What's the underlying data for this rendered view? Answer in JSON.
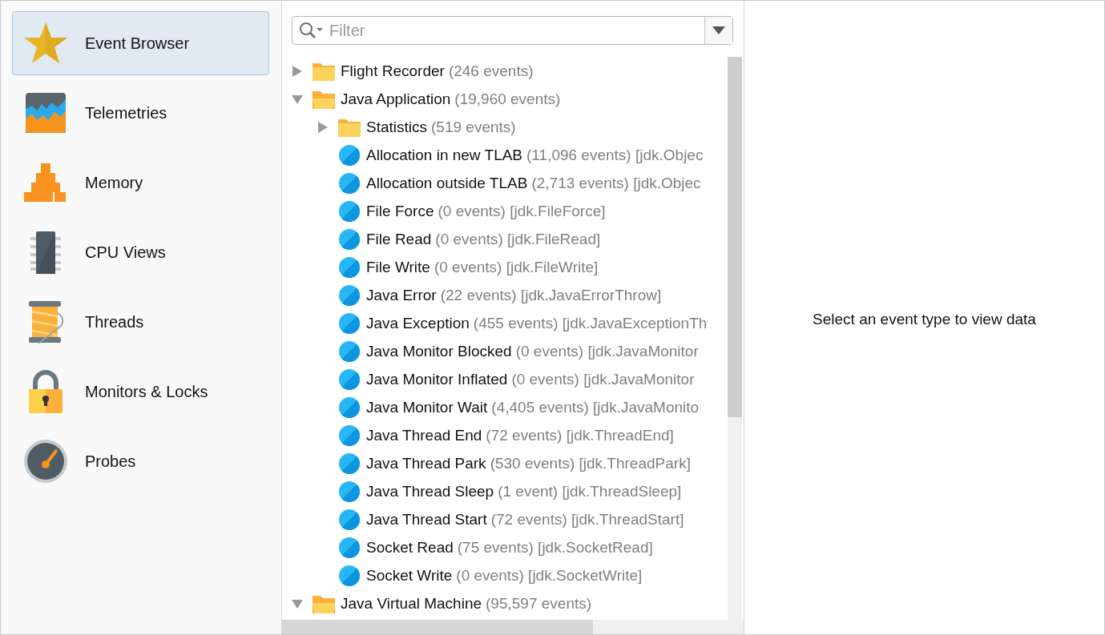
{
  "sidebar": {
    "items": [
      {
        "kind": "star",
        "label": "Event Browser",
        "selected": true
      },
      {
        "kind": "telemetry",
        "label": "Telemetries",
        "selected": false
      },
      {
        "kind": "memory",
        "label": "Memory",
        "selected": false
      },
      {
        "kind": "cpu",
        "label": "CPU Views",
        "selected": false
      },
      {
        "kind": "threads",
        "label": "Threads",
        "selected": false
      },
      {
        "kind": "lock",
        "label": "Monitors & Locks",
        "selected": false
      },
      {
        "kind": "probe",
        "label": "Probes",
        "selected": false
      }
    ]
  },
  "filter": {
    "placeholder": "Filter"
  },
  "tree": [
    {
      "kind": "folder",
      "label": "Flight Recorder",
      "detail": "(246 events)",
      "expanded": false
    },
    {
      "kind": "folder",
      "label": "Java Application",
      "detail": "(19,960 events)",
      "expanded": true,
      "children": [
        {
          "kind": "folder",
          "label": "Statistics",
          "detail": "(519 events)",
          "expanded": false
        },
        {
          "kind": "event",
          "label": "Allocation in new TLAB",
          "detail": "(11,096 events) [jdk.Objec"
        },
        {
          "kind": "event",
          "label": "Allocation outside TLAB",
          "detail": "(2,713 events) [jdk.Objec"
        },
        {
          "kind": "event",
          "label": "File Force",
          "detail": "(0 events) [jdk.FileForce]"
        },
        {
          "kind": "event",
          "label": "File Read",
          "detail": "(0 events) [jdk.FileRead]"
        },
        {
          "kind": "event",
          "label": "File Write",
          "detail": "(0 events) [jdk.FileWrite]"
        },
        {
          "kind": "event",
          "label": "Java Error",
          "detail": "(22 events) [jdk.JavaErrorThrow]"
        },
        {
          "kind": "event",
          "label": "Java Exception",
          "detail": "(455 events) [jdk.JavaExceptionTh"
        },
        {
          "kind": "event",
          "label": "Java Monitor Blocked",
          "detail": "(0 events) [jdk.JavaMonitor"
        },
        {
          "kind": "event",
          "label": "Java Monitor Inflated",
          "detail": "(0 events) [jdk.JavaMonitor"
        },
        {
          "kind": "event",
          "label": "Java Monitor Wait",
          "detail": "(4,405 events) [jdk.JavaMonito"
        },
        {
          "kind": "event",
          "label": "Java Thread End",
          "detail": "(72 events) [jdk.ThreadEnd]"
        },
        {
          "kind": "event",
          "label": "Java Thread Park",
          "detail": "(530 events) [jdk.ThreadPark]"
        },
        {
          "kind": "event",
          "label": "Java Thread Sleep",
          "detail": "(1 event) [jdk.ThreadSleep]"
        },
        {
          "kind": "event",
          "label": "Java Thread Start",
          "detail": "(72 events) [jdk.ThreadStart]"
        },
        {
          "kind": "event",
          "label": "Socket Read",
          "detail": "(75 events) [jdk.SocketRead]"
        },
        {
          "kind": "event",
          "label": "Socket Write",
          "detail": "(0 events) [jdk.SocketWrite]"
        }
      ]
    },
    {
      "kind": "folder",
      "label": "Java Virtual Machine",
      "detail": "(95,597 events)",
      "expanded": true
    }
  ],
  "detail_panel": {
    "message": "Select an event type to view data"
  }
}
